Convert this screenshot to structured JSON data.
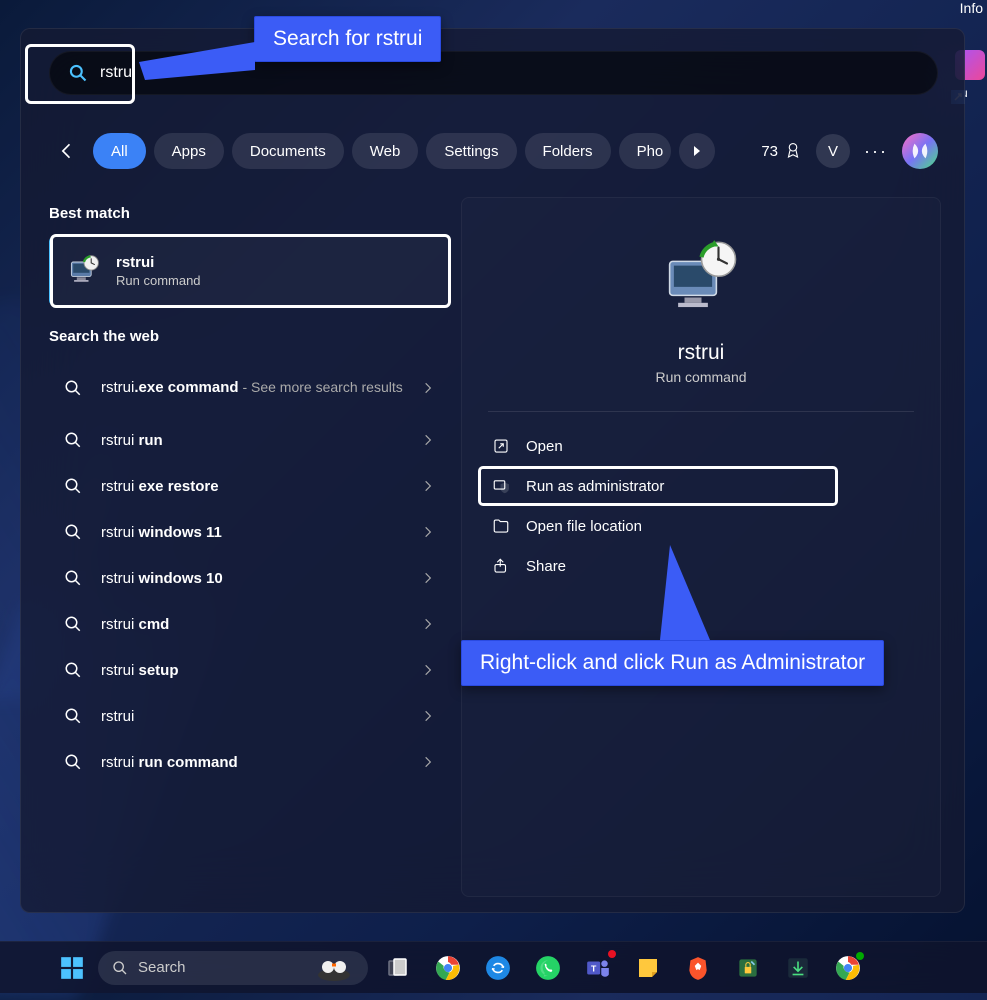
{
  "desktop": {
    "info_label": "Info",
    "shortcut_label": "su"
  },
  "search": {
    "query": "rstrui",
    "filters": [
      "All",
      "Apps",
      "Documents",
      "Web",
      "Settings",
      "Folders",
      "Pho"
    ],
    "active_filter_index": 0,
    "rewards_points": "73",
    "user_initial": "V",
    "best_match_heading": "Best match",
    "best_match": {
      "title": "rstrui",
      "subtitle": "Run command"
    },
    "web_heading": "Search the web",
    "web_results": [
      {
        "prefix": "rstrui",
        "bold": ".exe command",
        "suffix": " - See more search results"
      },
      {
        "prefix": "rstrui ",
        "bold": "run",
        "suffix": ""
      },
      {
        "prefix": "rstrui ",
        "bold": "exe restore",
        "suffix": ""
      },
      {
        "prefix": "rstrui ",
        "bold": "windows 11",
        "suffix": ""
      },
      {
        "prefix": "rstrui ",
        "bold": "windows 10",
        "suffix": ""
      },
      {
        "prefix": "rstrui ",
        "bold": "cmd",
        "suffix": ""
      },
      {
        "prefix": "rstrui ",
        "bold": "setup",
        "suffix": ""
      },
      {
        "prefix": "rstrui",
        "bold": "",
        "suffix": ""
      },
      {
        "prefix": "rstrui ",
        "bold": "run command",
        "suffix": ""
      }
    ],
    "detail": {
      "title": "rstrui",
      "subtitle": "Run command",
      "actions": [
        "Open",
        "Run as administrator",
        "Open file location",
        "Share"
      ]
    }
  },
  "annotations": {
    "top": "Search for rstrui",
    "bottom": "Right-click and click Run as Administrator"
  },
  "taskbar": {
    "search_placeholder": "Search"
  }
}
